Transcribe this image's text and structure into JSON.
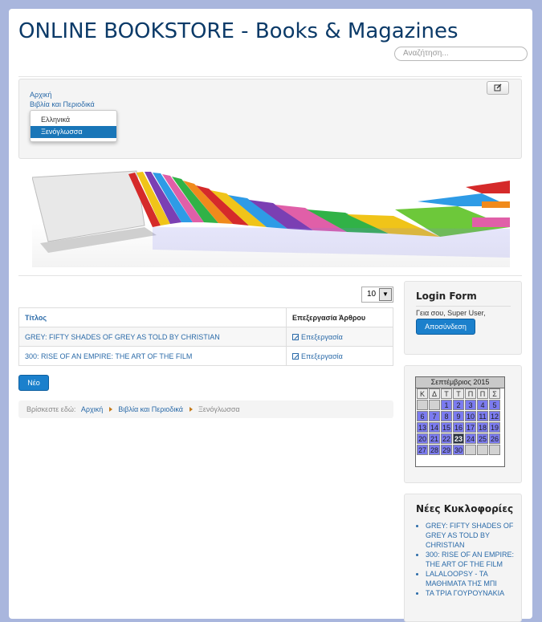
{
  "site": {
    "title": "ONLINE BOOKSTORE - Books & Magazines",
    "search_placeholder": "Αναζήτηση..."
  },
  "menu": {
    "edit_icon": "edit-icon",
    "home": "Αρχική",
    "category": "Βιβλία και Περιοδικά",
    "dropdown": [
      "Ελληνικά",
      "Ξενόγλωσσα"
    ],
    "dropdown_active_index": 1
  },
  "list": {
    "limit_value": "10",
    "headers": [
      "Τίτλος",
      "Επεξεργασία Άρθρου"
    ],
    "rows": [
      {
        "title": "GREY: FIFTY SHADES OF GREY AS TOLD BY CHRISTIAN",
        "edit": "Επεξεργασία"
      },
      {
        "title": "300: RISE OF AN EMPIRE: THE ART OF THE FILM",
        "edit": "Επεξεργασία"
      }
    ],
    "new_button": "Νέο"
  },
  "breadcrumb": {
    "prefix": "Βρίσκεστε εδώ:",
    "items": [
      "Αρχική",
      "Βιβλία και Περιοδικά",
      "Ξενόγλωσσα"
    ]
  },
  "login": {
    "title": "Login Form",
    "greeting": "Γεια σου, Super User,",
    "logout": "Αποσύνδεση"
  },
  "calendar": {
    "month": "Σεπτέμβριος 2015",
    "weekdays": [
      "Κ",
      "Δ",
      "Τ",
      "Τ",
      "Π",
      "Π",
      "Σ"
    ],
    "first_weekday_index": 2,
    "days_in_month": 30,
    "today": 23
  },
  "releases": {
    "title": "Νέες Κυκλοφορίες",
    "items": [
      "GREY: FIFTY SHADES OF GREY AS TOLD BY CHRISTIAN",
      "300: RISE OF AN EMPIRE: THE ART OF THE FILM",
      "LALALOOPSY - ΤΑ ΜΑΘΗΜΑΤΑ ΤΗΣ ΜΠΙ",
      "ΤΑ ΤΡΙΑ ΓΟΥΡΟΥΝΑΚΙΑ"
    ]
  },
  "colors": {
    "page_bg": "#a9b6dd",
    "title": "#0b3a68",
    "link": "#2a6aa8",
    "button": "#1b80cc",
    "calendar_day": "#7b7bef",
    "calendar_today": "#2c3544"
  }
}
